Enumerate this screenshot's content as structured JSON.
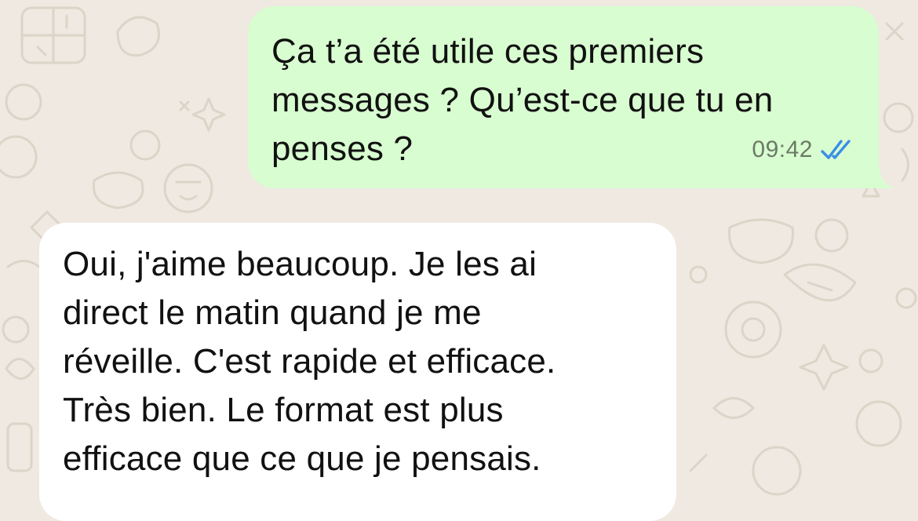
{
  "chat": {
    "messages": [
      {
        "direction": "outgoing",
        "text": "Ça t’a été utile ces premiers\nmessages ? Qu’est-ce que tu en\npenses ?",
        "time": "09:42",
        "status": "read",
        "status_icon": "double-check-icon"
      },
      {
        "direction": "incoming",
        "text": "Oui, j'aime beaucoup. Je les ai\ndirect le matin quand je me\nréveille. C'est rapide et efficace.\nTrès bien. Le format est plus\nefficace que ce que je pensais."
      }
    ]
  },
  "colors": {
    "background": "#efe9e1",
    "outgoing_bubble": "#d8fdd0",
    "incoming_bubble": "#ffffff",
    "read_tick": "#3a8ee6",
    "time_text": "#6b7a66"
  }
}
